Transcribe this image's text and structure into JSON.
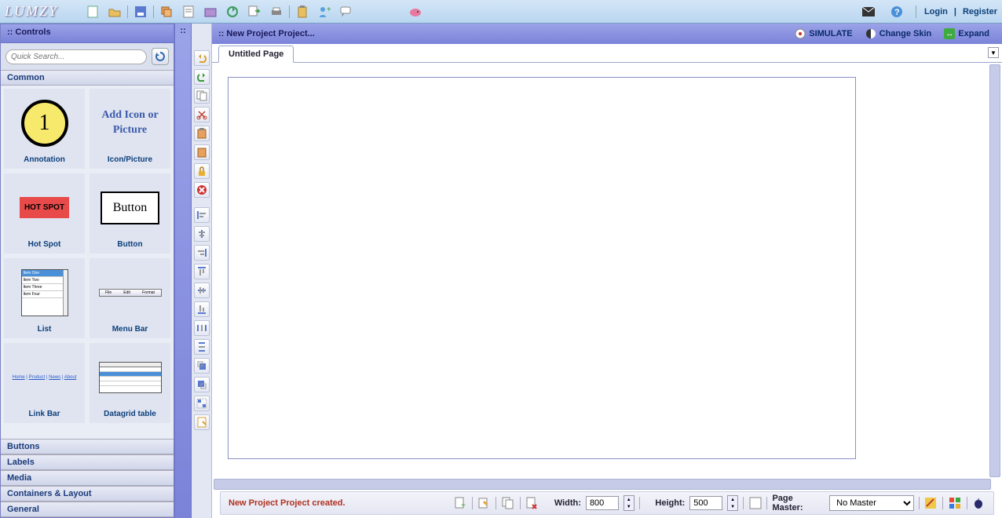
{
  "app": {
    "logo": "LUMZY"
  },
  "top_right": {
    "login": "Login",
    "sep": "|",
    "register": "Register"
  },
  "controls": {
    "panel_title": ":: Controls",
    "search_placeholder": "Quick Search...",
    "sections": {
      "common": "Common",
      "buttons": "Buttons",
      "labels": "Labels",
      "media": "Media",
      "containers": "Containers & Layout",
      "general": "General"
    },
    "items": {
      "annotation": {
        "label": "Annotation",
        "thumb_text": "1"
      },
      "iconpic": {
        "label": "Icon/Picture",
        "thumb_text": "Add Icon or Picture"
      },
      "hotspot": {
        "label": "Hot Spot",
        "thumb_text": "HOT SPOT"
      },
      "button": {
        "label": "Button",
        "thumb_text": "Button"
      },
      "list": {
        "label": "List"
      },
      "menubar": {
        "label": "Menu Bar"
      },
      "linkbar": {
        "label": "Link Bar"
      },
      "datagrid": {
        "label": "Datagrid table"
      }
    }
  },
  "handle": {
    "dots": "::"
  },
  "canvas": {
    "project_title": ":: New Project Project...",
    "simulate": "SIMULATE",
    "change_skin": "Change Skin",
    "expand": "Expand",
    "tab_label": "Untitled Page"
  },
  "bottom": {
    "status": "New Project Project created.",
    "width_label": "Width:",
    "width_value": "800",
    "height_label": "Height:",
    "height_value": "500",
    "master_label": "Page Master:",
    "master_value": "No Master"
  }
}
